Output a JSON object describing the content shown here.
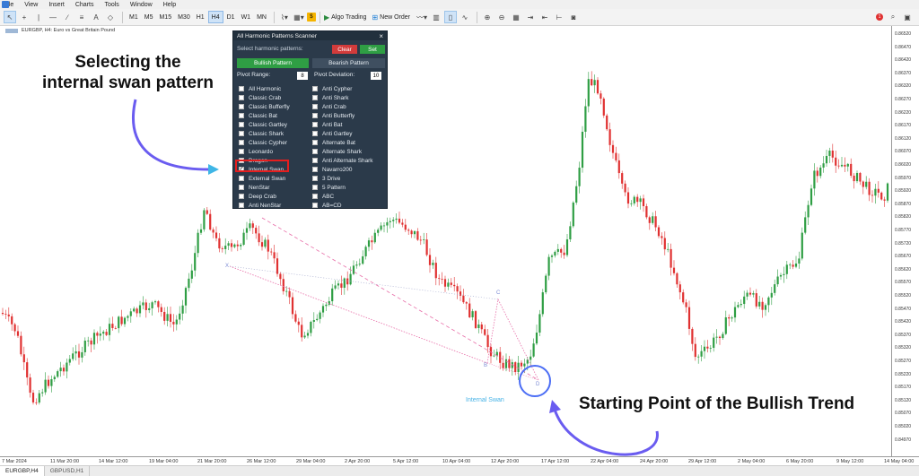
{
  "menu": [
    "File",
    "View",
    "Insert",
    "Charts",
    "Tools",
    "Window",
    "Help"
  ],
  "toolbar": {
    "timeframes": [
      "M1",
      "M5",
      "M15",
      "M30",
      "H1",
      "H4",
      "D1",
      "W1",
      "MN"
    ],
    "active_timeframe": "H4",
    "algo_trading": "Algo Trading",
    "new_order": "New Order",
    "notifications": "1"
  },
  "chart": {
    "header": "EURGBP, H4:  Euro vs Great Britain Pound",
    "price_labels": [
      "0.86520",
      "0.86470",
      "0.86420",
      "0.86370",
      "0.86320",
      "0.86270",
      "0.86220",
      "0.86170",
      "0.86120",
      "0.86070",
      "0.86020",
      "0.85970",
      "0.85920",
      "0.85870",
      "0.85820",
      "0.85770",
      "0.85720",
      "0.85670",
      "0.85620",
      "0.85570",
      "0.85520",
      "0.85470",
      "0.85420",
      "0.85370",
      "0.85320",
      "0.85270",
      "0.85220",
      "0.85170",
      "0.85120",
      "0.85070",
      "0.85020",
      "0.84970"
    ],
    "time_labels": [
      "7 Mar 2024",
      "11 Mar 20:00",
      "14 Mar 12:00",
      "19 Mar 04:00",
      "21 Mar 20:00",
      "26 Mar 12:00",
      "29 Mar 04:00",
      "2 Apr 20:00",
      "5 Apr 12:00",
      "10 Apr 04:00",
      "12 Apr 20:00",
      "17 Apr 12:00",
      "22 Apr 04:00",
      "24 Apr 20:00",
      "29 Apr 12:00",
      "2 May 04:00",
      "6 May 20:00",
      "9 May 12:00",
      "14 May 04:00"
    ],
    "pattern_points": [
      "X",
      "C",
      "B",
      "D"
    ],
    "pattern_name": "Internal Swan"
  },
  "scanner": {
    "title": "All Harmonic Patterns Scanner",
    "close": "×",
    "select_label": "Select harmonic patterns:",
    "clear": "Clear",
    "set": "Set",
    "bullish": "Bullish Pattern",
    "bearish": "Bearish Pattern",
    "pivot_range_label": "Pivot Range:",
    "pivot_range_value": "8",
    "pivot_deviation_label": "Pivot Deviation:",
    "pivot_deviation_value": "10",
    "left_patterns": [
      "All Harmonic",
      "Classic Crab",
      "Classic Bufferfly",
      "Classic Bat",
      "Classic Gartley",
      "Classic Shark",
      "Classic Cypher",
      "Leonardo",
      "Dragon",
      "Internal Swan",
      "External Swan",
      "NenStar",
      "Deep Crab",
      "Anti NenStar"
    ],
    "right_patterns": [
      "Anti Cypher",
      "Anti Shark",
      "Anti Crab",
      "Anti Butterfly",
      "Anti Bat",
      "Anti Gartley",
      "Alternate Bat",
      "Alternate Shark",
      "Anti Alternate Shark",
      "Navarro200",
      "3 Drive",
      "5 Pattern",
      "ABC",
      "AB=CD"
    ],
    "checked": "Internal Swan"
  },
  "annotations": {
    "left_line1": "Selecting the",
    "left_line2": "internal swan pattern",
    "right": "Starting Point of the Bullish Trend"
  },
  "tabs": [
    "EURGBP,H4",
    "GBPUSD,H1"
  ],
  "colors": {
    "bull": "#2f9e44",
    "bear": "#e03131",
    "pattern": "#e86ea8",
    "accent": "#46b2e6"
  }
}
